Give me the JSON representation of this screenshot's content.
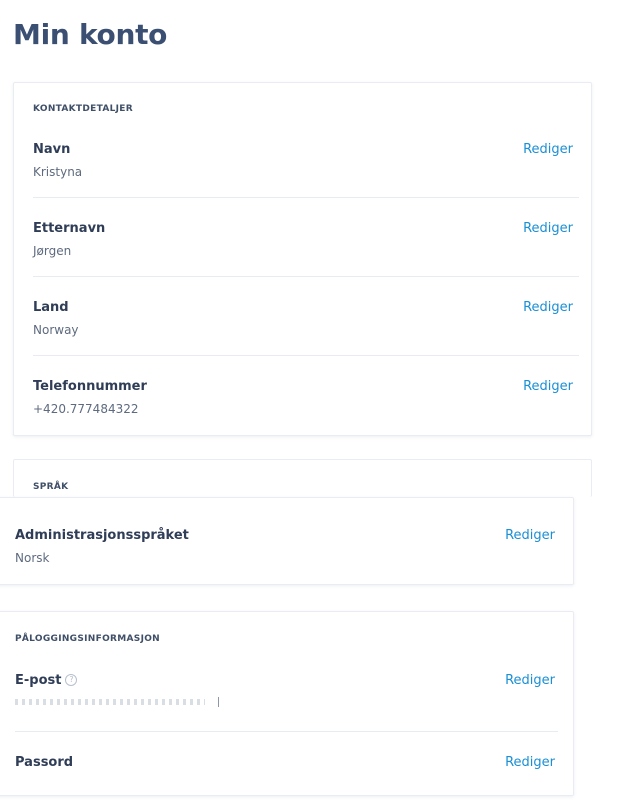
{
  "page": {
    "title": "Min konto"
  },
  "contact": {
    "header": "KONTAKTDETALJER",
    "rows": [
      {
        "label": "Navn",
        "value": "Kristyna",
        "edit": "Rediger"
      },
      {
        "label": "Etternavn",
        "value": "Jørgen",
        "edit": "Rediger"
      },
      {
        "label": "Land",
        "value": "Norway",
        "edit": "Rediger"
      },
      {
        "label": "Telefonnummer",
        "value": "+420.777484322",
        "edit": "Rediger"
      }
    ]
  },
  "language": {
    "header": "SPRÅK",
    "rows": [
      {
        "label": "Administrasjonsspråket",
        "value": "Norsk",
        "edit": "Rediger"
      }
    ]
  },
  "login": {
    "header": "PÅLOGGINGSINFORMASJON",
    "rows": [
      {
        "label": "E-post",
        "value": "",
        "edit": "Rediger",
        "icon": "help-icon"
      },
      {
        "label": "Passord",
        "value": "",
        "edit": "Rediger"
      }
    ]
  }
}
